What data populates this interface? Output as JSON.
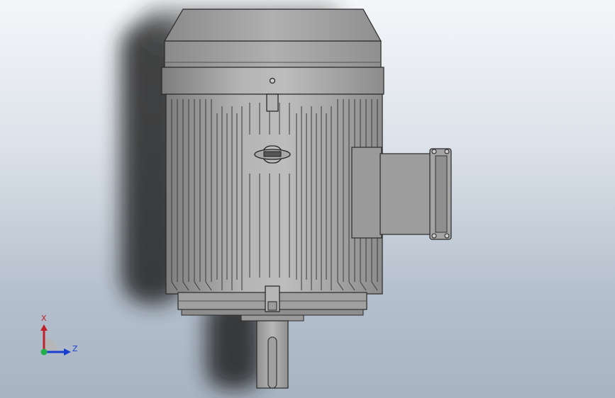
{
  "viewport": {
    "background_top": "#f4f6f9",
    "background_bottom": "#a8b4c2",
    "model_description_icon": "electric-motor-model"
  },
  "model": {
    "body_color": "#a8a8a8",
    "dark_color": "#8a8a8a",
    "edge_color": "#2a2a2a"
  },
  "triad": {
    "x_label": "X",
    "z_label": "Z",
    "x_color": "#c0202a",
    "z_color": "#1a3fd0",
    "y_color": "#22b04a"
  }
}
